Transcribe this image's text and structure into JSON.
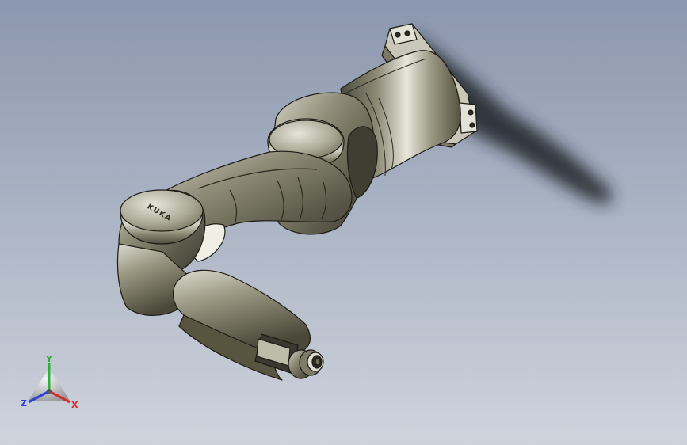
{
  "viewport": {
    "background_top": "#8b97ae",
    "background_bottom": "#cfd3dc"
  },
  "model": {
    "name": "robot-arm",
    "logo_text": "KUKA",
    "body_color": "#8a8774",
    "highlight_color": "#e6e5da",
    "edge_color": "#1c1c16"
  },
  "triad": {
    "x_label": "X",
    "y_label": "Y",
    "z_label": "Z",
    "x_color": "#d62a2a",
    "y_color": "#2fae3a",
    "z_color": "#2a3fd6"
  }
}
